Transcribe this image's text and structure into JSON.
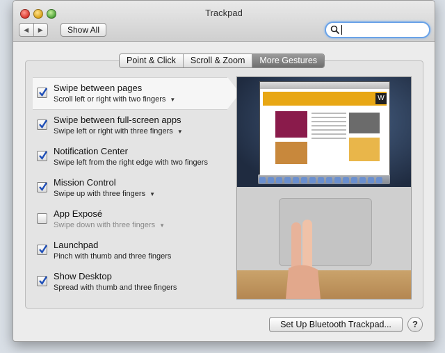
{
  "window": {
    "title": "Trackpad"
  },
  "toolbar": {
    "back_label": "◀",
    "forward_label": "▶",
    "show_all_label": "Show All",
    "search_value": ""
  },
  "tabs": [
    {
      "label": "Point & Click",
      "active": false
    },
    {
      "label": "Scroll & Zoom",
      "active": false
    },
    {
      "label": "More Gestures",
      "active": true
    }
  ],
  "gestures": [
    {
      "title": "Swipe between pages",
      "subtitle": "Scroll left or right with two fingers",
      "checked": true,
      "has_menu": true,
      "selected": true,
      "enabled": true
    },
    {
      "title": "Swipe between full-screen apps",
      "subtitle": "Swipe left or right with three fingers",
      "checked": true,
      "has_menu": true,
      "selected": false,
      "enabled": true
    },
    {
      "title": "Notification Center",
      "subtitle": "Swipe left from the right edge with two fingers",
      "checked": true,
      "has_menu": false,
      "selected": false,
      "enabled": true
    },
    {
      "title": "Mission Control",
      "subtitle": "Swipe up with three fingers",
      "checked": true,
      "has_menu": true,
      "selected": false,
      "enabled": true
    },
    {
      "title": "App Exposé",
      "subtitle": "Swipe down with three fingers",
      "checked": false,
      "has_menu": true,
      "selected": false,
      "enabled": false
    },
    {
      "title": "Launchpad",
      "subtitle": "Pinch with thumb and three fingers",
      "checked": true,
      "has_menu": false,
      "selected": false,
      "enabled": true
    },
    {
      "title": "Show Desktop",
      "subtitle": "Spread with thumb and three fingers",
      "checked": true,
      "has_menu": false,
      "selected": false,
      "enabled": true
    }
  ],
  "footer": {
    "bluetooth_label": "Set Up Bluetooth Trackpad...",
    "help_label": "?"
  },
  "preview": {
    "logo_letter": "W"
  },
  "colors": {
    "accent": "#2e6ee0",
    "tab_active": "#7a7a7a"
  }
}
